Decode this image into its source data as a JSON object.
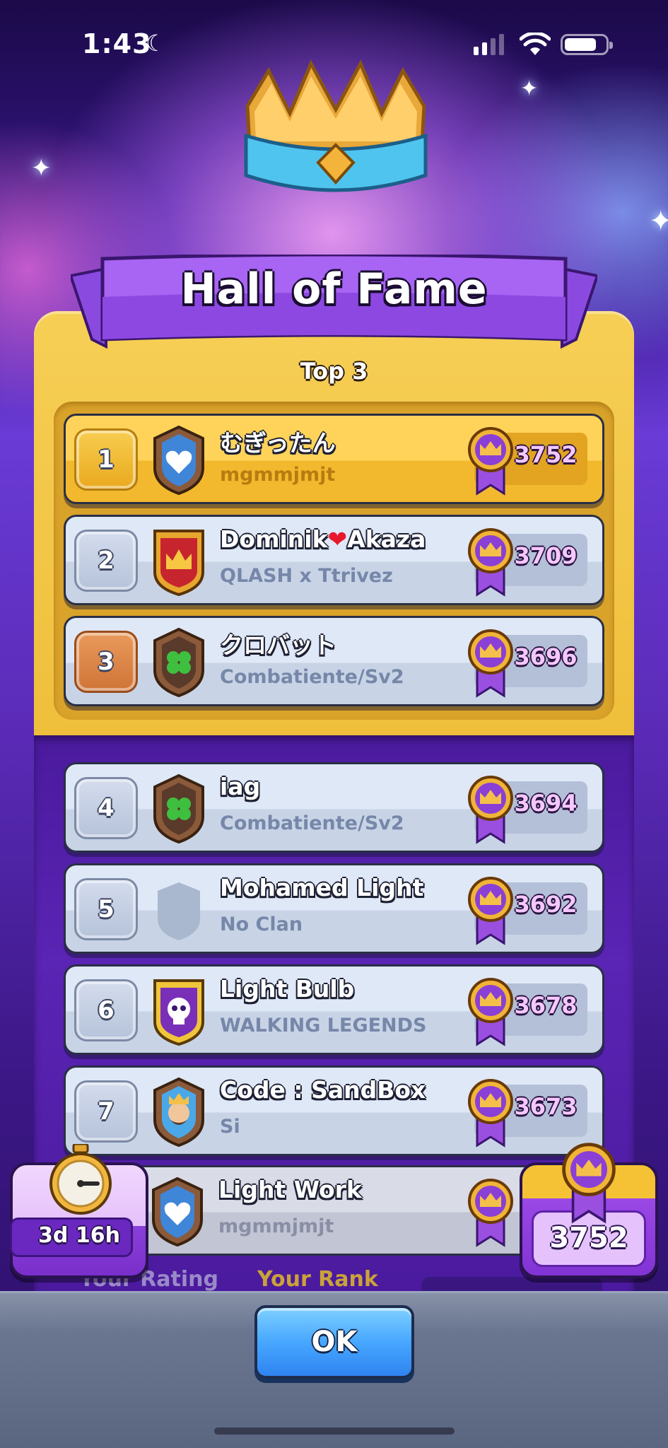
{
  "status_bar": {
    "time": "1:43"
  },
  "title": "Hall of Fame",
  "section_label": "Top 3",
  "players": [
    {
      "rank": "1",
      "name": "むぎったん",
      "clan": "mgmmjmjt",
      "rating": "3752",
      "badge": "heart-badge"
    },
    {
      "rank": "2",
      "name_part1": "Dominik",
      "name_part2": "Akaza",
      "clan": "QLASH x Ttrivez",
      "rating": "3709",
      "badge": "crown-badge"
    },
    {
      "rank": "3",
      "name": "クロバット",
      "clan": "Combatiente/Sv2",
      "rating": "3696",
      "badge": "clover-badge"
    },
    {
      "rank": "4",
      "name": "iag",
      "clan": "Combatiente/Sv2",
      "rating": "3694",
      "badge": "clover-badge"
    },
    {
      "rank": "5",
      "name": "Mohamed Light",
      "clan": "No Clan",
      "rating": "3692",
      "badge": "empty-badge"
    },
    {
      "rank": "6",
      "name": "Light Bulb",
      "clan": "WALKING LEGENDS",
      "rating": "3678",
      "badge": "skull-badge"
    },
    {
      "rank": "7",
      "name": "Code : SandBox",
      "clan": "Si",
      "rating": "3673",
      "badge": "king-badge"
    }
  ],
  "current_player": {
    "name": "Light Work",
    "clan": "mgmmjmjt"
  },
  "season_timer": "3d 16h",
  "my_rating": "3752",
  "labels": {
    "your_rating": "Your Rating",
    "your_rank": "Your Rank"
  },
  "ok_button": "OK",
  "colors": {
    "gold": "#f6cf55",
    "purple": "#5a24b4",
    "ok_blue": "#47a7ff",
    "rating_text": "#f4c8ff"
  }
}
